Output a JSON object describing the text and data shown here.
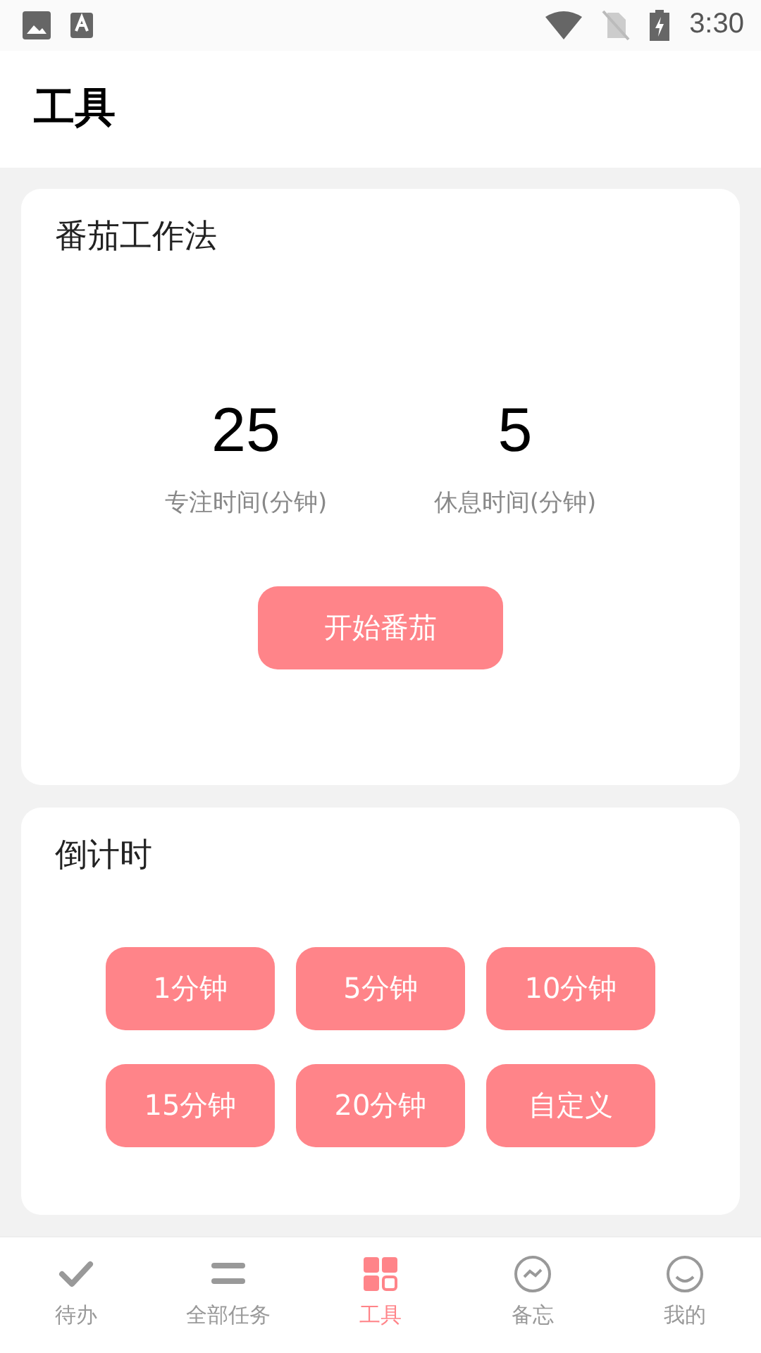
{
  "status_bar": {
    "time": "3:30"
  },
  "header": {
    "title": "工具"
  },
  "pomodoro": {
    "title": "番茄工作法",
    "stats": [
      {
        "value": "25",
        "label": "专注时间(分钟)"
      },
      {
        "value": "5",
        "label": "休息时间(分钟)"
      }
    ],
    "button": "开始番茄"
  },
  "countdown": {
    "title": "倒计时",
    "buttons": [
      "1分钟",
      "5分钟",
      "10分钟",
      "15分钟",
      "20分钟",
      "自定义"
    ]
  },
  "bottom_nav": [
    {
      "kind": "check",
      "label": "待办",
      "selected": false
    },
    {
      "kind": "list",
      "label": "全部任务",
      "selected": false
    },
    {
      "kind": "grid",
      "label": "工具",
      "selected": true
    },
    {
      "kind": "memo",
      "label": "备忘",
      "selected": false
    },
    {
      "kind": "face",
      "label": "我的",
      "selected": false
    }
  ]
}
